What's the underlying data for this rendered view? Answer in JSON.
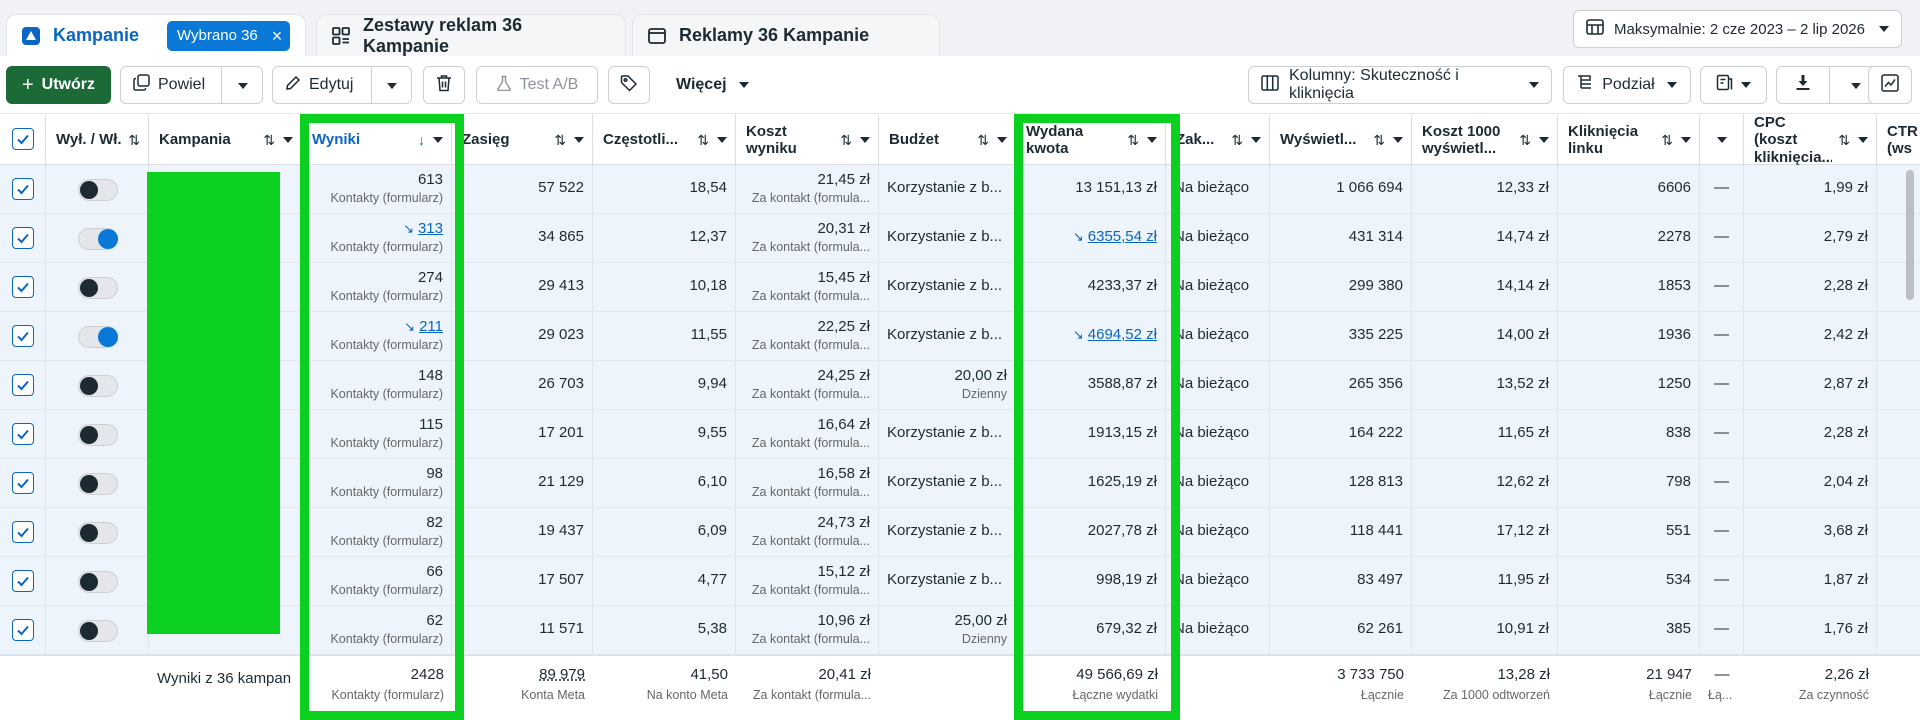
{
  "tabs": {
    "campaigns": "Kampanie",
    "selected_badge": "Wybrano 36",
    "adsets": "Zestawy reklam 36 Kampanie",
    "ads": "Reklamy 36 Kampanie"
  },
  "date_range": "Maksymalnie: 2 cze 2023 – 2 lip 2026",
  "toolbar": {
    "create": "Utwórz",
    "duplicate": "Powiel",
    "edit": "Edytuj",
    "ab_test": "Test A/B",
    "more": "Więcej",
    "columns": "Kolumny: Skuteczność i kliknięcia",
    "breakdown": "Podział"
  },
  "headers": {
    "toggle": "Wył. / Wł.",
    "campaign": "Kampania",
    "results": "Wyniki",
    "reach": "Zasięg",
    "frequency": "Częstotli...",
    "cost_per_result": "Koszt wyniku",
    "budget": "Budżet",
    "spent": "Wydana kwota",
    "ends": "Zak...",
    "impressions": "Wyświetl...",
    "cpm": "Koszt 1000 wyświetl...",
    "link_clicks": "Kliknięcia linku",
    "cpc": "CPC (koszt kliknięcia...",
    "ctr": "CTR (ws"
  },
  "rows": [
    {
      "on": false,
      "results": "613",
      "results_trend": false,
      "reach": "57 522",
      "freq": "18,54",
      "cpr": "21,45 zł",
      "budget": "Korzystanie z b...",
      "budget_sub": "",
      "spent": "13 151,13 zł",
      "spent_trend": false,
      "status": "Na bieżąco",
      "impr": "1 066 694",
      "cpm": "12,33 zł",
      "clicks": "6606",
      "dash": "—",
      "cpc": "1,99 zł"
    },
    {
      "on": true,
      "results": "313",
      "results_trend": true,
      "reach": "34 865",
      "freq": "12,37",
      "cpr": "20,31 zł",
      "budget": "Korzystanie z b...",
      "budget_sub": "",
      "spent": "6355,54 zł",
      "spent_trend": true,
      "status": "Na bieżąco",
      "impr": "431 314",
      "cpm": "14,74 zł",
      "clicks": "2278",
      "dash": "—",
      "cpc": "2,79 zł"
    },
    {
      "on": false,
      "results": "274",
      "results_trend": false,
      "reach": "29 413",
      "freq": "10,18",
      "cpr": "15,45 zł",
      "budget": "Korzystanie z b...",
      "budget_sub": "",
      "spent": "4233,37 zł",
      "spent_trend": false,
      "status": "Na bieżąco",
      "impr": "299 380",
      "cpm": "14,14 zł",
      "clicks": "1853",
      "dash": "—",
      "cpc": "2,28 zł"
    },
    {
      "on": true,
      "results": "211",
      "results_trend": true,
      "reach": "29 023",
      "freq": "11,55",
      "cpr": "22,25 zł",
      "budget": "Korzystanie z b...",
      "budget_sub": "",
      "spent": "4694,52 zł",
      "spent_trend": true,
      "status": "Na bieżąco",
      "impr": "335 225",
      "cpm": "14,00 zł",
      "clicks": "1936",
      "dash": "—",
      "cpc": "2,42 zł"
    },
    {
      "on": false,
      "results": "148",
      "results_trend": false,
      "reach": "26 703",
      "freq": "9,94",
      "cpr": "24,25 zł",
      "budget": "20,00 zł",
      "budget_sub": "Dzienny",
      "spent": "3588,87 zł",
      "spent_trend": false,
      "status": "Na bieżąco",
      "impr": "265 356",
      "cpm": "13,52 zł",
      "clicks": "1250",
      "dash": "—",
      "cpc": "2,87 zł"
    },
    {
      "on": false,
      "results": "115",
      "results_trend": false,
      "reach": "17 201",
      "freq": "9,55",
      "cpr": "16,64 zł",
      "budget": "Korzystanie z b...",
      "budget_sub": "",
      "spent": "1913,15 zł",
      "spent_trend": false,
      "status": "Na bieżąco",
      "impr": "164 222",
      "cpm": "11,65 zł",
      "clicks": "838",
      "dash": "—",
      "cpc": "2,28 zł"
    },
    {
      "on": false,
      "results": "98",
      "results_trend": false,
      "reach": "21 129",
      "freq": "6,10",
      "cpr": "16,58 zł",
      "budget": "Korzystanie z b...",
      "budget_sub": "",
      "spent": "1625,19 zł",
      "spent_trend": false,
      "status": "Na bieżąco",
      "impr": "128 813",
      "cpm": "12,62 zł",
      "clicks": "798",
      "dash": "—",
      "cpc": "2,04 zł"
    },
    {
      "on": false,
      "results": "82",
      "results_trend": false,
      "reach": "19 437",
      "freq": "6,09",
      "cpr": "24,73 zł",
      "budget": "Korzystanie z b...",
      "budget_sub": "",
      "spent": "2027,78 zł",
      "spent_trend": false,
      "status": "Na bieżąco",
      "impr": "118 441",
      "cpm": "17,12 zł",
      "clicks": "551",
      "dash": "—",
      "cpc": "3,68 zł"
    },
    {
      "on": false,
      "results": "66",
      "results_trend": false,
      "reach": "17 507",
      "freq": "4,77",
      "cpr": "15,12 zł",
      "budget": "Korzystanie z b...",
      "budget_sub": "",
      "spent": "998,19 zł",
      "spent_trend": false,
      "status": "Na bieżąco",
      "impr": "83 497",
      "cpm": "11,95 zł",
      "clicks": "534",
      "dash": "—",
      "cpc": "1,87 zł"
    },
    {
      "on": false,
      "results": "62",
      "results_trend": false,
      "reach": "11 571",
      "freq": "5,38",
      "cpr": "10,96 zł",
      "budget": "25,00 zł",
      "budget_sub": "Dzienny",
      "spent": "679,32 zł",
      "spent_trend": false,
      "status": "Na bieżąco",
      "impr": "62 261",
      "cpm": "10,91 zł",
      "clicks": "385",
      "dash": "—",
      "cpc": "1,76 zł"
    }
  ],
  "row_subs": {
    "results": "Kontakty (formularz)",
    "cpr": "Za kontakt (formula..."
  },
  "footer": {
    "label": "Wyniki z 36 kampan",
    "results": "2428",
    "results_sub": "Kontakty (formularz)",
    "reach": "89 979",
    "reach_sub": "Konta Meta",
    "freq": "41,50",
    "freq_sub": "Na konto Meta",
    "cpr": "20,41 zł",
    "cpr_sub": "Za kontakt (formula...",
    "spent": "49 566,69 zł",
    "spent_sub": "Łączne wydatki",
    "impr": "3 733 750",
    "impr_sub": "Łącznie",
    "cpm": "13,28 zł",
    "cpm_sub": "Za 1000 odtworzeń",
    "clicks": "21 947",
    "clicks_sub": "Łącznie",
    "dash": "—",
    "dash_sub": "Łą...",
    "cpc": "2,26 zł",
    "cpc_sub": "Za czynność"
  },
  "colors": {
    "accent": "#0a66c2",
    "highlight": "#0bd01f",
    "create_button": "#1b6a38"
  }
}
